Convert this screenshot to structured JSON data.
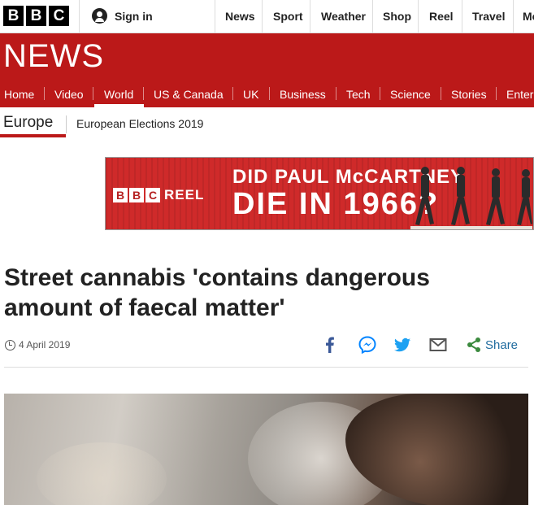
{
  "topbar": {
    "logo": [
      "B",
      "B",
      "C"
    ],
    "signin_label": "Sign in",
    "links": [
      "News",
      "Sport",
      "Weather",
      "Shop",
      "Reel",
      "Travel",
      "Mo"
    ]
  },
  "masthead": {
    "title": "NEWS"
  },
  "nav": {
    "items": [
      "Home",
      "Video",
      "World",
      "US & Canada",
      "UK",
      "Business",
      "Tech",
      "Science",
      "Stories",
      "Enter"
    ],
    "active": "World"
  },
  "section": {
    "title": "Europe",
    "sublink": "European Elections 2019"
  },
  "ad": {
    "brand_logo": [
      "B",
      "B",
      "C"
    ],
    "brand_label": "REEL",
    "line1": "DID PAUL McCARTNEY",
    "line2": "DIE IN 1966?"
  },
  "article": {
    "headline": "Street cannabis 'contains dangerous amount of faecal matter'",
    "date": "4 April 2019",
    "share_label": "Share"
  },
  "icons": {
    "facebook": "facebook-icon",
    "messenger": "messenger-icon",
    "twitter": "twitter-icon",
    "email": "email-icon",
    "share": "share-icon",
    "clock": "clock-icon",
    "user": "user-icon"
  },
  "colors": {
    "brand_red": "#bb1919",
    "share_blue": "#1f6b9e",
    "facebook_blue": "#3b5998",
    "messenger_blue": "#0084ff",
    "twitter_blue": "#1da1f2",
    "share_green": "#3b8a3e"
  }
}
